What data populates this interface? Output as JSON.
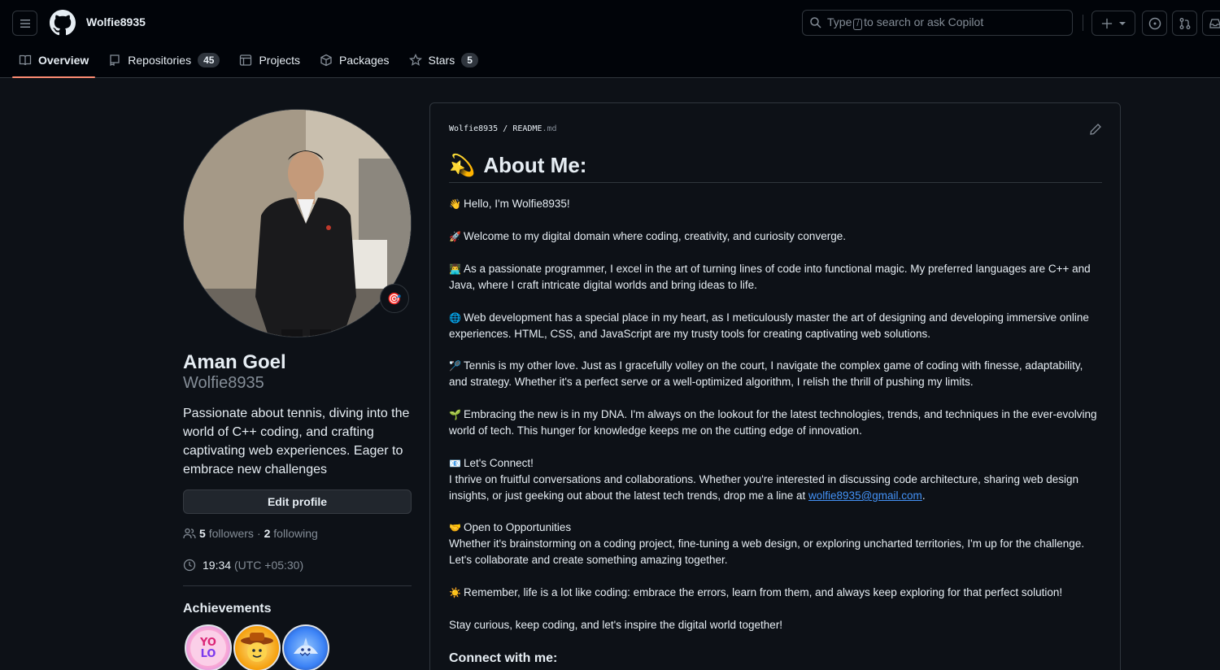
{
  "header": {
    "username": "Wolfie8935",
    "search": {
      "prefix": "Type",
      "key": "/",
      "suffix": "to search or ask Copilot"
    }
  },
  "tabs": [
    {
      "label": "Overview",
      "icon": "book-icon"
    },
    {
      "label": "Repositories",
      "count": "45",
      "icon": "repo-icon"
    },
    {
      "label": "Projects",
      "icon": "table-icon"
    },
    {
      "label": "Packages",
      "icon": "package-icon"
    },
    {
      "label": "Stars",
      "count": "5",
      "icon": "star-icon"
    }
  ],
  "profile": {
    "full_name": "Aman Goel",
    "login": "Wolfie8935",
    "bio": "Passionate about tennis, diving into the world of C++ coding, and crafting captivating web experiences. Eager to embrace new challenges",
    "edit_label": "Edit profile",
    "followers_count": "5",
    "followers_label": "followers",
    "dot": "·",
    "following_count": "2",
    "following_label": "following",
    "time": "19:34",
    "timezone": "(UTC +05:30)",
    "achievements_title": "Achievements"
  },
  "readme": {
    "path_owner": "Wolfie8935",
    "path_sep": "/",
    "path_file": "README",
    "path_ext": ".md",
    "heading": "About Me:",
    "paragraphs": {
      "p1": "Hello, I'm Wolfie8935!",
      "p2": "Welcome to my digital domain where coding, creativity, and curiosity converge.",
      "p3": "As a passionate programmer, I excel in the art of turning lines of code into functional magic. My preferred languages are C++ and Java, where I craft intricate digital worlds and bring ideas to life.",
      "p4": "Web development has a special place in my heart, as I meticulously master the art of designing and developing immersive online experiences. HTML, CSS, and JavaScript are my trusty tools for creating captivating web solutions.",
      "p5": "Tennis is my other love. Just as I gracefully volley on the court, I navigate the complex game of coding with finesse, adaptability, and strategy. Whether it's a perfect serve or a well-optimized algorithm, I relish the thrill of pushing my limits.",
      "p6": "Embracing the new is in my DNA. I'm always on the lookout for the latest technologies, trends, and techniques in the ever-evolving world of tech. This hunger for knowledge keeps me on the cutting edge of innovation.",
      "p7_title": "Let's Connect!",
      "p7_body": "I thrive on fruitful conversations and collaborations. Whether you're interested in discussing code architecture, sharing web design insights, or just geeking out about the latest tech trends, drop me a line at",
      "email": "wolfie8935@gmail.com",
      "p7_end": ".",
      "p8_title": "Open to Opportunities",
      "p8_body": "Whether it's brainstorming on a coding project, fine-tuning a web design, or exploring uncharted territories, I'm up for the challenge. Let's collaborate and create something amazing together.",
      "p9": "Remember, life is a lot like coding: embrace the errors, learn from them, and always keep exploring for that perfect solution!",
      "p10": "Stay curious, keep coding, and let's inspire the digital world together!"
    },
    "connect_heading": "Connect with me:"
  },
  "emojis": {
    "heading": "💫",
    "wave": "👋",
    "rocket": "🚀",
    "technologist": "👨‍💻",
    "globe": "🌐",
    "tennis": "🏸",
    "seedling": "🌱",
    "mail": "📧",
    "handshake": "🤝",
    "sun": "☀️",
    "status": "🎯"
  },
  "colors": {
    "accent_underline": "#fd8c73",
    "link": "#4493f8",
    "background": "#0d1117",
    "header_bg": "#010409"
  }
}
